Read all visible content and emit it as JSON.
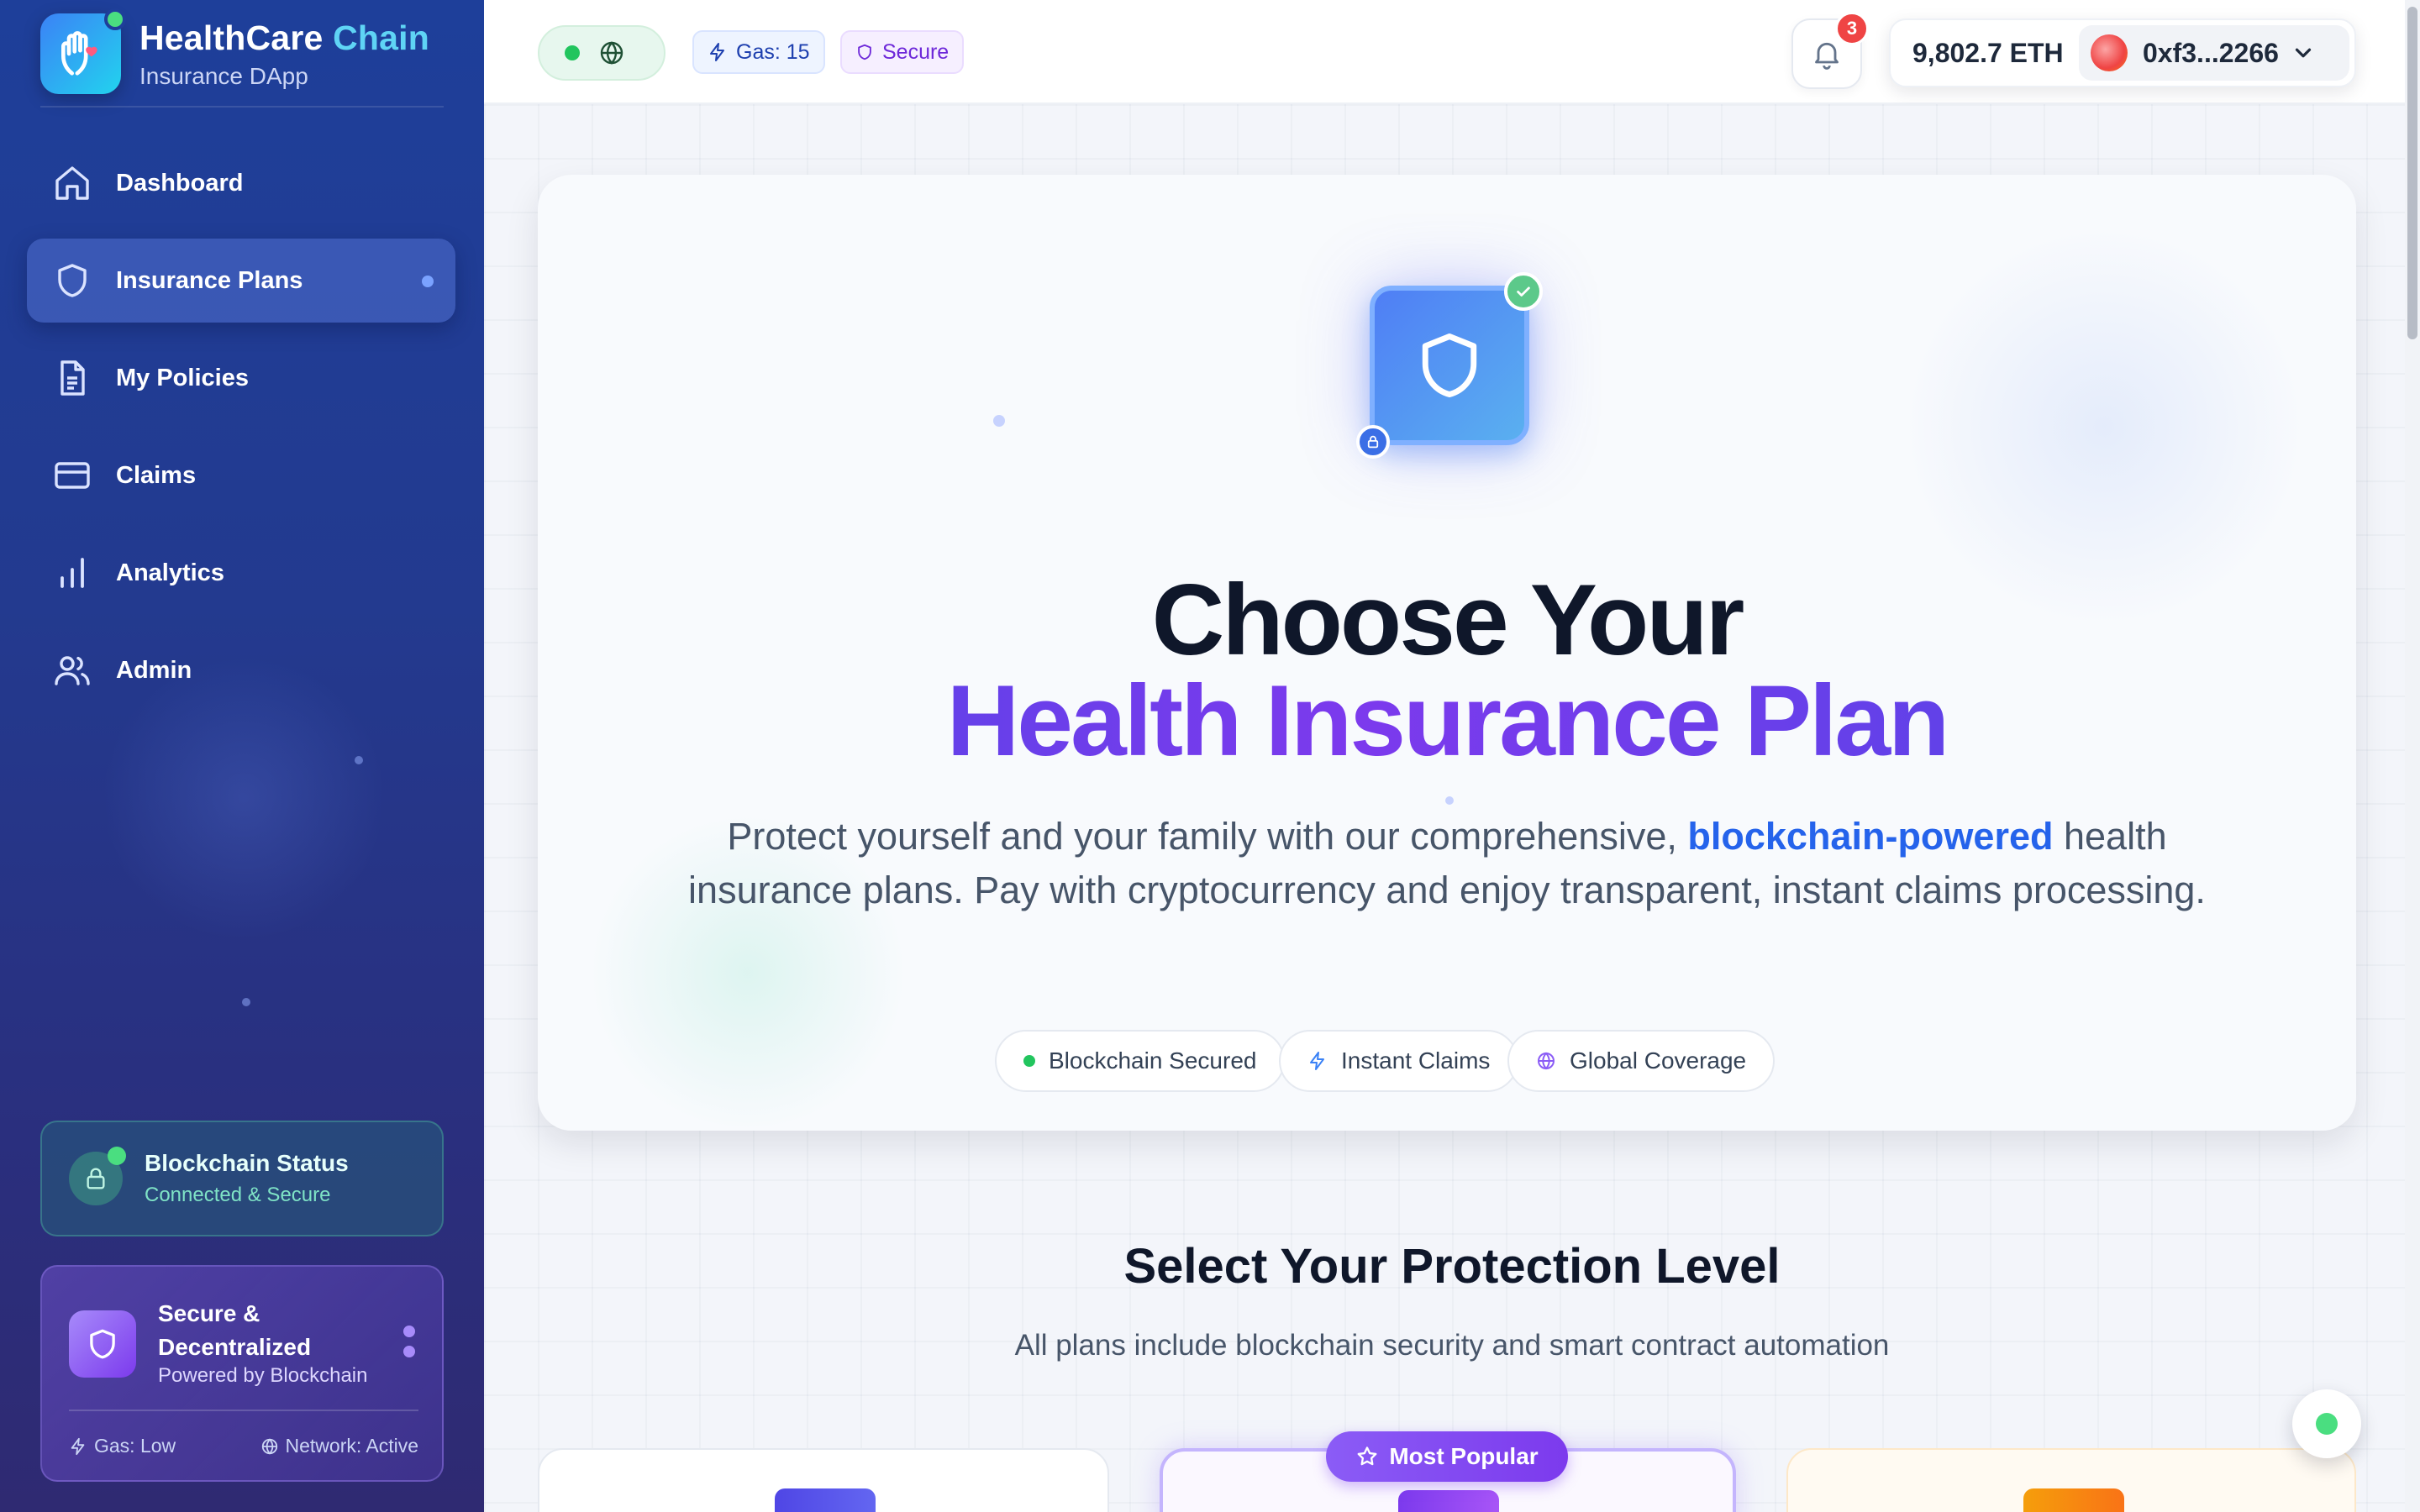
{
  "brand": {
    "name_primary": "HealthCare",
    "name_accent": "Chain",
    "subtitle": "Insurance DApp"
  },
  "sidebar": {
    "items": [
      {
        "label": "Dashboard",
        "icon": "home-icon",
        "active": false
      },
      {
        "label": "Insurance Plans",
        "icon": "shield-icon",
        "active": true
      },
      {
        "label": "My Policies",
        "icon": "document-icon",
        "active": false
      },
      {
        "label": "Claims",
        "icon": "credit-card-icon",
        "active": false
      },
      {
        "label": "Analytics",
        "icon": "bar-chart-icon",
        "active": false
      },
      {
        "label": "Admin",
        "icon": "users-icon",
        "active": false
      }
    ],
    "status_card": {
      "title": "Blockchain Status",
      "subtitle": "Connected & Secure"
    },
    "secure_card": {
      "title": "Secure & Decentralized",
      "subtitle": "Powered by Blockchain",
      "gas": "Gas: Low",
      "network": "Network: Active"
    }
  },
  "header": {
    "gas_chip": "Gas: 15",
    "secure_chip": "Secure",
    "notification_count": "3",
    "balance": "9,802.7 ETH",
    "address": "0xf3...2266"
  },
  "hero": {
    "title_line1": "Choose Your",
    "title_line2": "Health Insurance Plan",
    "desc_before": "Protect yourself and your family with our comprehensive, ",
    "desc_highlight": "blockchain-powered",
    "desc_after": " health insurance plans. Pay with cryptocurrency and enjoy transparent, instant claims processing.",
    "pills": [
      "Blockchain Secured",
      "Instant Claims",
      "Global Coverage"
    ]
  },
  "plans_section": {
    "heading": "Select Your Protection Level",
    "subheading": "All plans include blockchain security and smart contract automation",
    "popular_badge": "Most Popular"
  },
  "colors": {
    "brand_blue": "#2563eb",
    "brand_purple": "#7c3aed",
    "success": "#22c55e",
    "danger": "#ef4444",
    "accent_cyan": "#5fd4f5"
  }
}
